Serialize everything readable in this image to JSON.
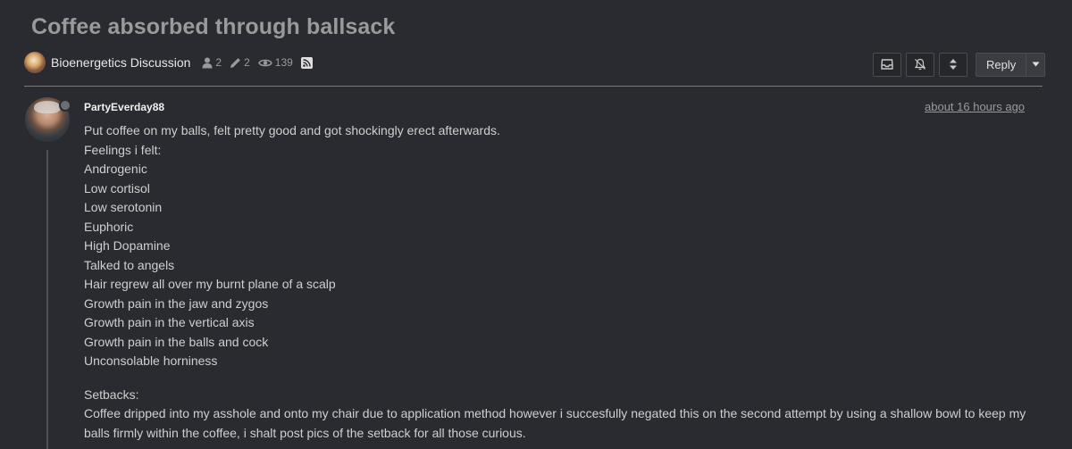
{
  "topic": {
    "title": "Coffee absorbed through ballsack",
    "category": "Bioenergetics Discussion",
    "participants": "2",
    "posts": "2",
    "views": "139"
  },
  "controls": {
    "reply_label": "Reply"
  },
  "icons": {
    "bookmark": "inbox-icon",
    "notifications": "bell-slash-icon",
    "expand": "up-down-chevron-icon",
    "caret": "caret-down-icon",
    "rss": "rss-icon"
  },
  "post": {
    "username": "PartyEverday88",
    "timestamp": "about 16 hours ago",
    "lines": [
      "Put coffee on my balls, felt pretty good and got shockingly erect afterwards.",
      "Feelings i felt:",
      "Androgenic",
      "Low cortisol",
      "Low serotonin",
      "Euphoric",
      "High Dopamine",
      "Talked to angels",
      "Hair regrew all over my burnt plane of a scalp",
      "Growth pain in the jaw and zygos",
      "Growth pain in the vertical axis",
      "Growth pain in the balls and cock",
      "Unconsolable horniness"
    ],
    "setbacks_heading": "Setbacks:",
    "setbacks_text": "Coffee dripped into my asshole and onto my chair due to application method however i succesfully negated this on the second attempt by using a shallow bowl to keep my balls firmly within the coffee, i shalt post pics of the setback for all those curious."
  },
  "colors": {
    "background": "#292b30",
    "title": "#9a9a9a",
    "text": "#cfcfcf",
    "divider": "#7a7a7a"
  }
}
